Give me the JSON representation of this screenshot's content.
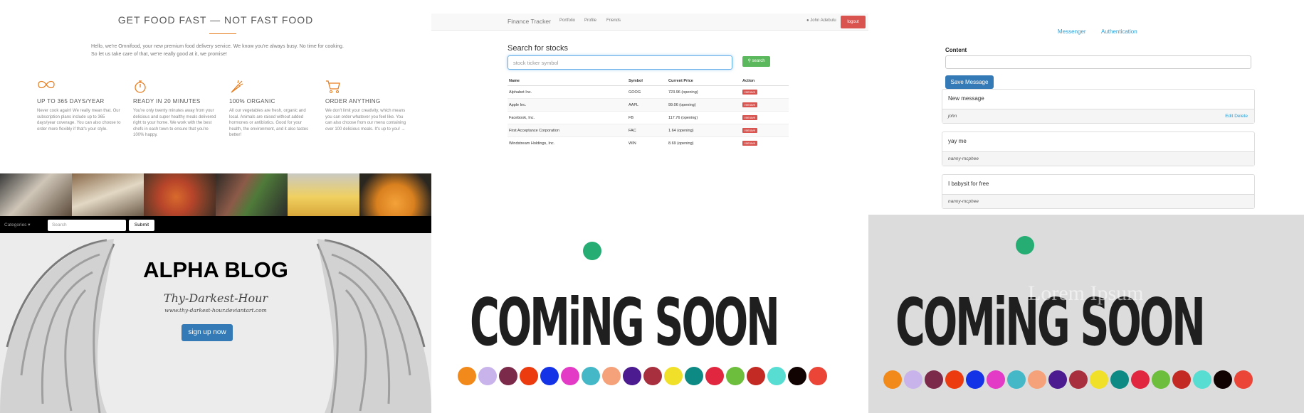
{
  "omnifood": {
    "title": "GET FOOD FAST — NOT FAST FOOD",
    "intro_1": "Hello, we're Omnifood, your new premium food delivery service. We know you're always busy. No time for cooking.",
    "intro_2": "So let us take care of that, we're really good at it, we promise!",
    "features": [
      {
        "icon": "infinity-icon",
        "title": "UP TO 365 DAYS/YEAR",
        "text": "Never cook again! We really mean that. Our subscription plans include up to 365 days/year coverage. You can also choose to order more flexibly if that's your style."
      },
      {
        "icon": "stopwatch-icon",
        "title": "READY IN 20 MINUTES",
        "text": "You're only twenty minutes away from your delicious and super healthy meals delivered right to your home. We work with the best chefs in each town to ensure that you're 100% happy."
      },
      {
        "icon": "carrot-icon",
        "title": "100% ORGANIC",
        "text": "All our vegetables are fresh, organic and local. Animals are raised without added hormones or antibiotics. Good for your health, the environment, and it also tastes better!"
      },
      {
        "icon": "cart-icon",
        "title": "ORDER ANYTHING",
        "text": "We don't limit your creativity, which means you can order whatever you feel like. You can also choose from our menu containing over 100 delicious meals. It's up to you! →"
      }
    ]
  },
  "finance": {
    "brand": "Finance Tracker",
    "nav": [
      "Portfolio",
      "Profile",
      "Friends"
    ],
    "user": "John Adebulu",
    "logout": "logout",
    "heading": "Search for stocks",
    "search_placeholder": "stock ticker symbol",
    "search_button": "search",
    "columns": [
      "Name",
      "Symbol",
      "Current Price",
      "Action"
    ],
    "rows": [
      {
        "name": "Alphabet Inc.",
        "symbol": "GOOG",
        "price": "723.96 (opening)",
        "action": "remove"
      },
      {
        "name": "Apple Inc.",
        "symbol": "AAPL",
        "price": "99.06 (opening)",
        "action": "remove"
      },
      {
        "name": "Facebook, Inc.",
        "symbol": "FB",
        "price": "117.76 (opening)",
        "action": "remove"
      },
      {
        "name": "First Acceptance Corporation",
        "symbol": "FAC",
        "price": "1.64 (opening)",
        "action": "remove"
      },
      {
        "name": "Windstream Holdings, Inc.",
        "symbol": "WIN",
        "price": "8.69 (opening)",
        "action": "remove"
      }
    ]
  },
  "messenger": {
    "links": [
      "Messenger",
      "Authentication"
    ],
    "content_label": "Content",
    "save_button": "Save Message",
    "messages": [
      {
        "text": "New message",
        "author": "john",
        "actions": "Edit Delete"
      },
      {
        "text": "yay me",
        "author": "nanny-mcphee",
        "actions": ""
      },
      {
        "text": "I babysit for free",
        "author": "nanny-mcphee",
        "actions": ""
      }
    ]
  },
  "blog": {
    "categories": "Categories",
    "search_placeholder": "Search",
    "submit": "Submit",
    "title": "ALPHA BLOG",
    "watermark": "Thy-Darkest-Hour",
    "watermark_url": "www.thy-darkest-hour.deviantart.com",
    "signup": "sign up now"
  },
  "coming_soon": {
    "headline": "COMiNG SOON",
    "overlay": "Lorem Ipsum",
    "accent": "#26ad73",
    "dot_colors": [
      "#f28a1b",
      "#c8b3ea",
      "#7c2a4a",
      "#ec3b0f",
      "#1433e6",
      "#e33bc6",
      "#45b8c8",
      "#f5a27a",
      "#4b1b8f",
      "#a8303e",
      "#f1e02a",
      "#0d8a83",
      "#e0273f",
      "#6dbe3d",
      "#c22a23",
      "#58ddd3",
      "#120303",
      "#eb4538"
    ]
  }
}
